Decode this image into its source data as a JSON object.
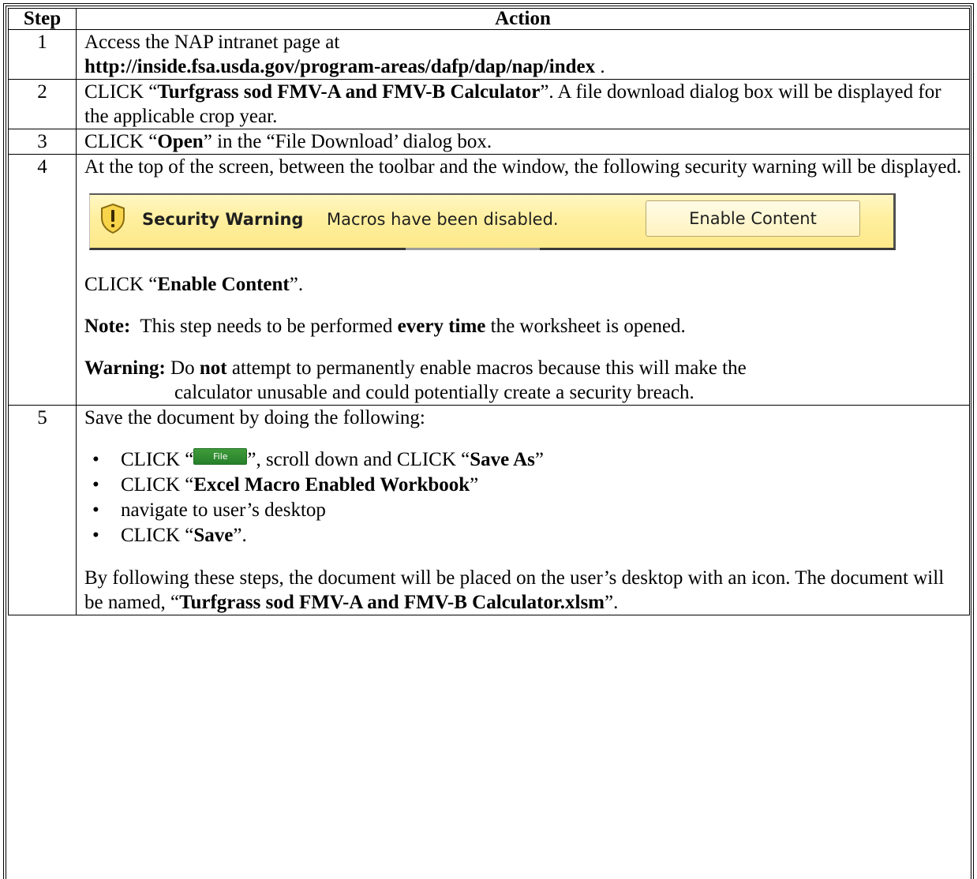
{
  "table": {
    "header": {
      "step": "Step",
      "action": "Action"
    },
    "step1": {
      "num": "1",
      "line1": "Access the NAP intranet page at",
      "url": "http://inside.fsa.usda.gov/program-areas/dafp/dap/nap/index",
      "url_suffix": " ."
    },
    "step2": {
      "num": "2",
      "pre": "CLICK “",
      "link": "Turfgrass sod FMV-A and FMV-B Calculator",
      "post": "”.  A file download dialog box will be displayed for the applicable crop year."
    },
    "step3": {
      "num": "3",
      "pre": "CLICK “",
      "bold": "Open",
      "post": "” in the “File Download’ dialog box."
    },
    "step4": {
      "num": "4",
      "intro": "At the top of the screen, between the toolbar and the window, the following security warning will be displayed.",
      "security_bar": {
        "title": "Security Warning",
        "message": "Macros have been disabled.",
        "button": "Enable Content"
      },
      "click_pre": "CLICK “",
      "click_bold": "Enable Content",
      "click_post": "”.",
      "note_label": "Note:",
      "note_pre": "  This step needs to be performed ",
      "note_bold": "every time",
      "note_post": " the worksheet is opened.",
      "warning_label": "Warning:",
      "warning_pre": " Do ",
      "warning_bold": "not",
      "warning_line1_post": " attempt to permanently enable macros because this will make the",
      "warning_line2": "calculator unusable and could potentially create a security breach."
    },
    "step5": {
      "num": "5",
      "intro": "Save the document by doing the following:",
      "bullet_char": "•",
      "b1_pre": "CLICK “",
      "file_button": "File",
      "b1_mid": "”, scroll down and CLICK “",
      "b1_bold": "Save As",
      "b1_post": "”",
      "b2_pre": "CLICK “",
      "b2_bold": "Excel Macro Enabled Workbook",
      "b2_post": "”",
      "b3": "navigate to user’s desktop",
      "b4_pre": "CLICK “",
      "b4_bold": "Save",
      "b4_post": "”.",
      "outro_pre": "By following these steps, the document will be placed on the user’s desktop with an icon.  The document will be named, “",
      "outro_bold": "Turfgrass sod FMV-A and FMV-B Calculator.xlsm",
      "outro_post": "”."
    }
  }
}
